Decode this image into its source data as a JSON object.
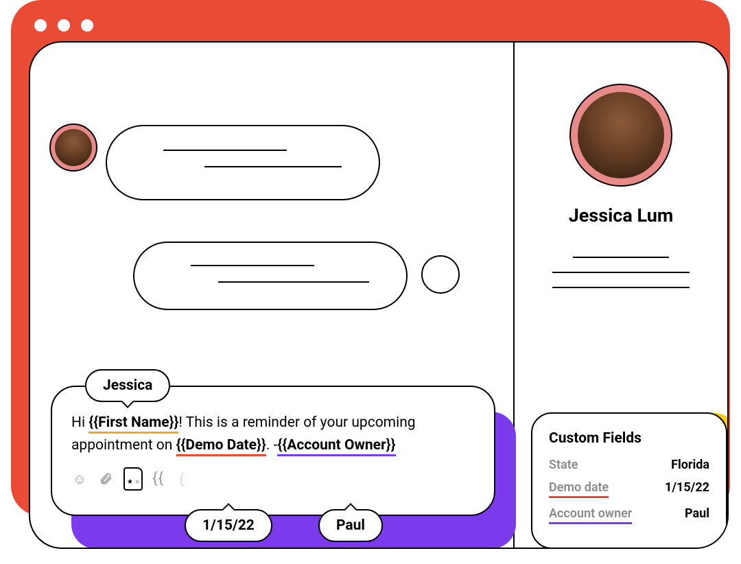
{
  "contact": {
    "name": "Jessica Lum"
  },
  "tooltips": {
    "first_name_value": "Jessica",
    "demo_date_value": "1/15/22",
    "account_owner_value": "Paul"
  },
  "compose": {
    "prefix": "Hi ",
    "token_first_name": "{{First Name}}",
    "mid1": "! This is a reminder of your upcoming appointment on ",
    "token_demo_date": "{{Demo Date}}",
    "mid2": ". -",
    "token_account_owner": "{{Account Owner}}",
    "toolbar_braces": "{{"
  },
  "custom_fields": {
    "title": "Custom Fields",
    "rows": [
      {
        "label": "State",
        "value": "Florida",
        "style": "none"
      },
      {
        "label": "Demo date",
        "value": "1/15/22",
        "style": "orange"
      },
      {
        "label": "Account owner",
        "value": "Paul",
        "style": "purple"
      }
    ]
  }
}
